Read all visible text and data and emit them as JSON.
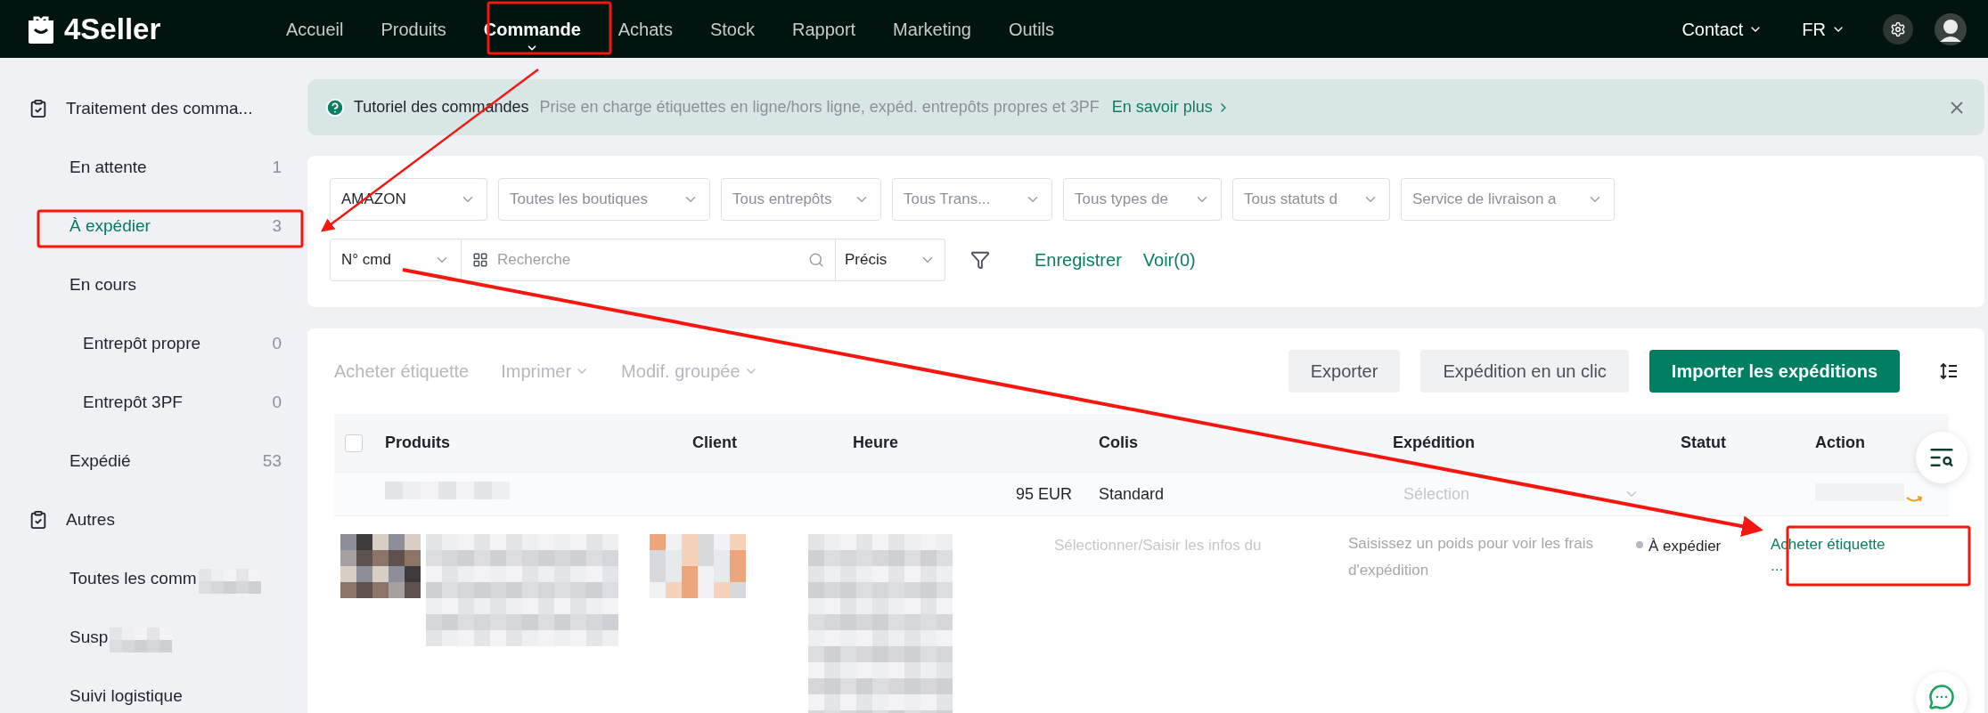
{
  "topbar": {
    "logo": "4Seller",
    "nav": [
      {
        "label": "Accueil",
        "selected": false
      },
      {
        "label": "Produits",
        "selected": false
      },
      {
        "label": "Commande",
        "selected": true
      },
      {
        "label": "Achats",
        "selected": false
      },
      {
        "label": "Stock",
        "selected": false
      },
      {
        "label": "Rapport",
        "selected": false
      },
      {
        "label": "Marketing",
        "selected": false
      },
      {
        "label": "Outils",
        "selected": false
      }
    ],
    "contact": "Contact",
    "language": "FR"
  },
  "sidebar": {
    "sections": [
      {
        "title": "Traitement des comma...",
        "items": [
          {
            "label": "En attente",
            "count": "1",
            "selected": false
          },
          {
            "label": "À expédier",
            "count": "3",
            "selected": true
          },
          {
            "label": "En cours",
            "selected": false,
            "children": [
              {
                "label": "Entrepôt propre",
                "count": "0",
                "selected": false
              },
              {
                "label": "Entrepôt 3PF",
                "count": "0",
                "selected": false
              }
            ]
          },
          {
            "label": "Expédié",
            "count": "53",
            "selected": false
          }
        ]
      },
      {
        "title": "Autres",
        "items": [
          {
            "label": "Toutes les comm",
            "selected": false,
            "blurred": true
          },
          {
            "label": "Susp",
            "selected": false,
            "blurred": true
          },
          {
            "label": "Suivi logistique",
            "selected": false
          }
        ]
      }
    ]
  },
  "banner": {
    "title": "Tutoriel des commandes",
    "text": "Prise en charge étiquettes en ligne/hors ligne, expéd. entrepôts propres et 3PF",
    "link": "En savoir plus"
  },
  "filters": [
    {
      "value": "AMAZON"
    },
    {
      "placeholder": "Toutes les boutiques"
    },
    {
      "placeholder": "Tous entrepôts"
    },
    {
      "placeholder": "Tous Trans..."
    },
    {
      "placeholder": "Tous types de"
    },
    {
      "placeholder": "Tous statuts d"
    },
    {
      "placeholder": "Service de livraison a"
    }
  ],
  "search": {
    "field": "N° cmd",
    "placeholder": "Recherche",
    "mode": "Précis",
    "save": "Enregistrer",
    "view": "Voir(0)"
  },
  "toolbar": {
    "actions": [
      {
        "label": "Acheter étiquette",
        "dropdown": false,
        "disabled": true
      },
      {
        "label": "Imprimer",
        "dropdown": true,
        "disabled": true
      },
      {
        "label": "Modif. groupée",
        "dropdown": true,
        "disabled": true
      }
    ],
    "buttons": [
      {
        "label": "Exporter",
        "primary": false
      },
      {
        "label": "Expédition en un clic",
        "primary": false
      },
      {
        "label": "Importer les expéditions",
        "primary": true
      }
    ]
  },
  "table": {
    "checked": false,
    "columns": [
      "Produits",
      "Client",
      "Heure",
      "Colis",
      "Expédition",
      "Statut",
      "Action"
    ],
    "groups": [
      {
        "amount": "95 EUR",
        "package": "Standard",
        "shipping_placeholder": "Sélection",
        "rows": [
          {
            "package_hint": "Sélectionner/Saisir les infos du",
            "shipping_hint": "Saisissez un poids pour voir les frais d'expédition",
            "status": "À expédier",
            "action": "Acheter étiquette",
            "more": "..."
          }
        ]
      }
    ]
  }
}
